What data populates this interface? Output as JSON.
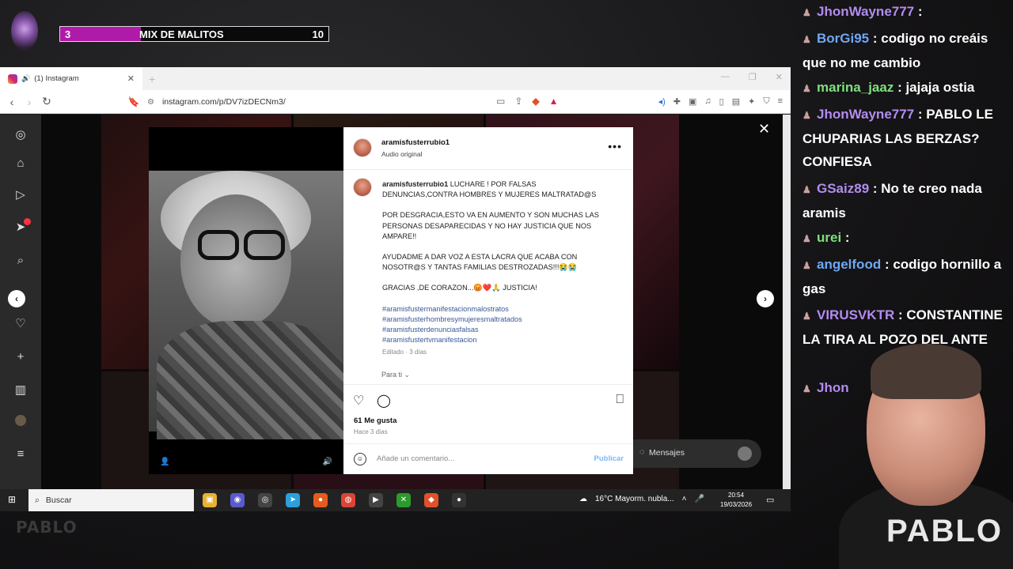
{
  "overlay": {
    "counter_left": "3",
    "counter_title": "MIX DE MALITOS",
    "counter_right": "10",
    "counter_fill_fraction": 0.3,
    "accent": "#b01aa8"
  },
  "browser": {
    "tab_title": "(1) Instagram",
    "url": "instagram.com/p/DV7izDECNm3/"
  },
  "post": {
    "username": "aramisfusterrubio1",
    "audio": "Audio original",
    "caption_user": "aramisfusterrubio1",
    "caption_lines": [
      "LUCHARE ! POR FALSAS DENUNCIAS,CONTRA HOMBRES Y MUJERES MALTRATAD@S",
      "POR DESGRACIA,ESTO VA EN AUMENTO Y SON MUCHAS LAS PERSONAS DESAPARECIDAS Y NO HAY JUSTICIA QUE NOS AMPARE!!",
      "AYUDADME A DAR VOZ A ESTA LACRA QUE ACABA CON NOSOTR@S Y TANTAS FAMILIAS DESTROZADAS!!!😭😭",
      "GRACIAS ,DE CORAZON...😡❤️🙏 JUSTICIA!"
    ],
    "hashtags": [
      "#aramisfustermanifestacionmalostratos",
      "#aramisfusterhombresymujeresmaltratados",
      "#aramisfusterdenunciasfalsas",
      "#aramisfustertvmanifestacion"
    ],
    "edited": "Editado · 3 días",
    "para_ti": "Para ti",
    "likes": "61 Me gusta",
    "ago": "Hace 3 días",
    "comment_placeholder": "Añade un comentario...",
    "publish": "Publicar"
  },
  "messages": {
    "label": "Mensajes"
  },
  "taskbar": {
    "search_placeholder": "Buscar",
    "weather": "16°C  Mayorm. nubla...",
    "time": "20:54",
    "date": "19/03/2026"
  },
  "watermark": "PABLO",
  "chat": [
    {
      "user": "JhonWayne777",
      "color": "#b38cf0",
      "text": ""
    },
    {
      "user": "BorGi95",
      "color": "#6fa8f5",
      "text": "codigo no creáis que no me cambio"
    },
    {
      "user": "marina_jaaz",
      "color": "#7ee07e",
      "text": "jajaja ostia"
    },
    {
      "user": "JhonWayne777",
      "color": "#b38cf0",
      "text": "PABLO LE CHUPARIAS LAS BERZAS? CONFIESA"
    },
    {
      "user": "GSaiz89",
      "color": "#b38cf0",
      "text": "No te creo nada aramis"
    },
    {
      "user": "urei",
      "color": "#7ee07e",
      "text": ""
    },
    {
      "user": "angelfood",
      "color": "#6fa8f5",
      "text": "codigo hornillo a gas"
    },
    {
      "user": "VIRUSVKTR",
      "color": "#b38cf0",
      "text": "CONSTANTINE LA TIRA AL POZO DEL"
    },
    {
      "user": "Jhon",
      "color": "#b38cf0",
      "text": ""
    }
  ],
  "chat_tail": "ANTE",
  "streamer_shirt": "PABLO"
}
